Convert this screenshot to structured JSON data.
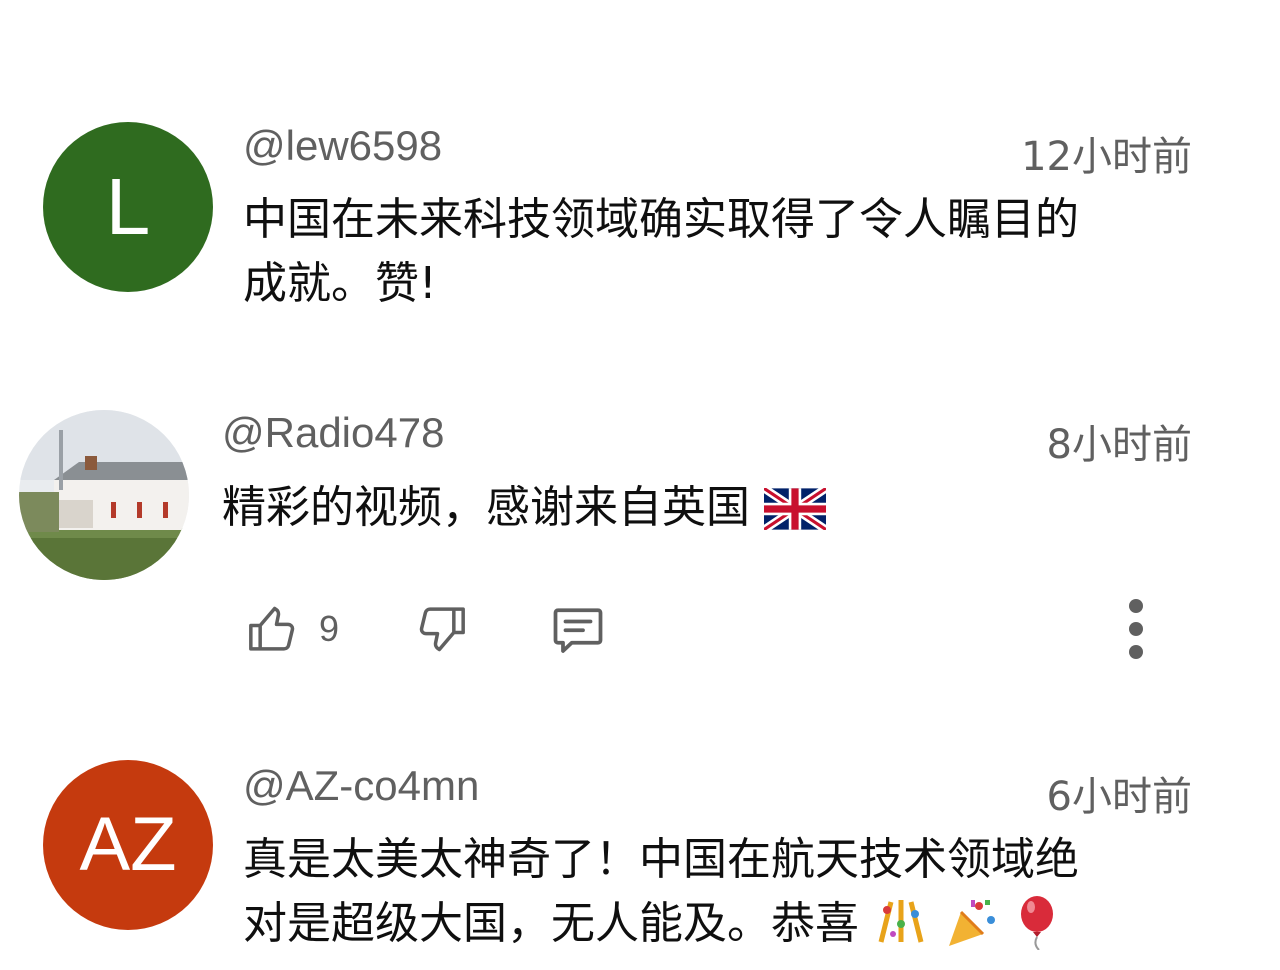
{
  "comments": [
    {
      "author": "@lew6598",
      "time": "12小时前",
      "avatar_letter": "L",
      "avatar_color": "#2f6b1f",
      "text_lines": [
        "中国在未来科技领域确实取得了令人瞩目的",
        "成就。赞!"
      ]
    },
    {
      "author": "@Radio478",
      "time": "8小时前",
      "text": "精彩的视频，感谢来自英国",
      "flag_icon": "uk-flag-icon",
      "like_count": "9",
      "actions": [
        "like-icon",
        "dislike-icon",
        "reply-icon",
        "more-vert-icon"
      ]
    },
    {
      "author": "@AZ-co4mn",
      "time": "6小时前",
      "avatar_letter": "AZ",
      "avatar_color": "#c53a0e",
      "text_lines": [
        "真是太美太神奇了！中国在航天技术领域绝",
        "对是超级大国，无人能及。恭喜"
      ],
      "emoji_icons": [
        "confetti-icon",
        "party-popper-icon",
        "balloon-icon"
      ]
    }
  ],
  "colors": {
    "meta_text": "#606060",
    "body_text": "#0f0f0f",
    "background": "#ffffff"
  }
}
